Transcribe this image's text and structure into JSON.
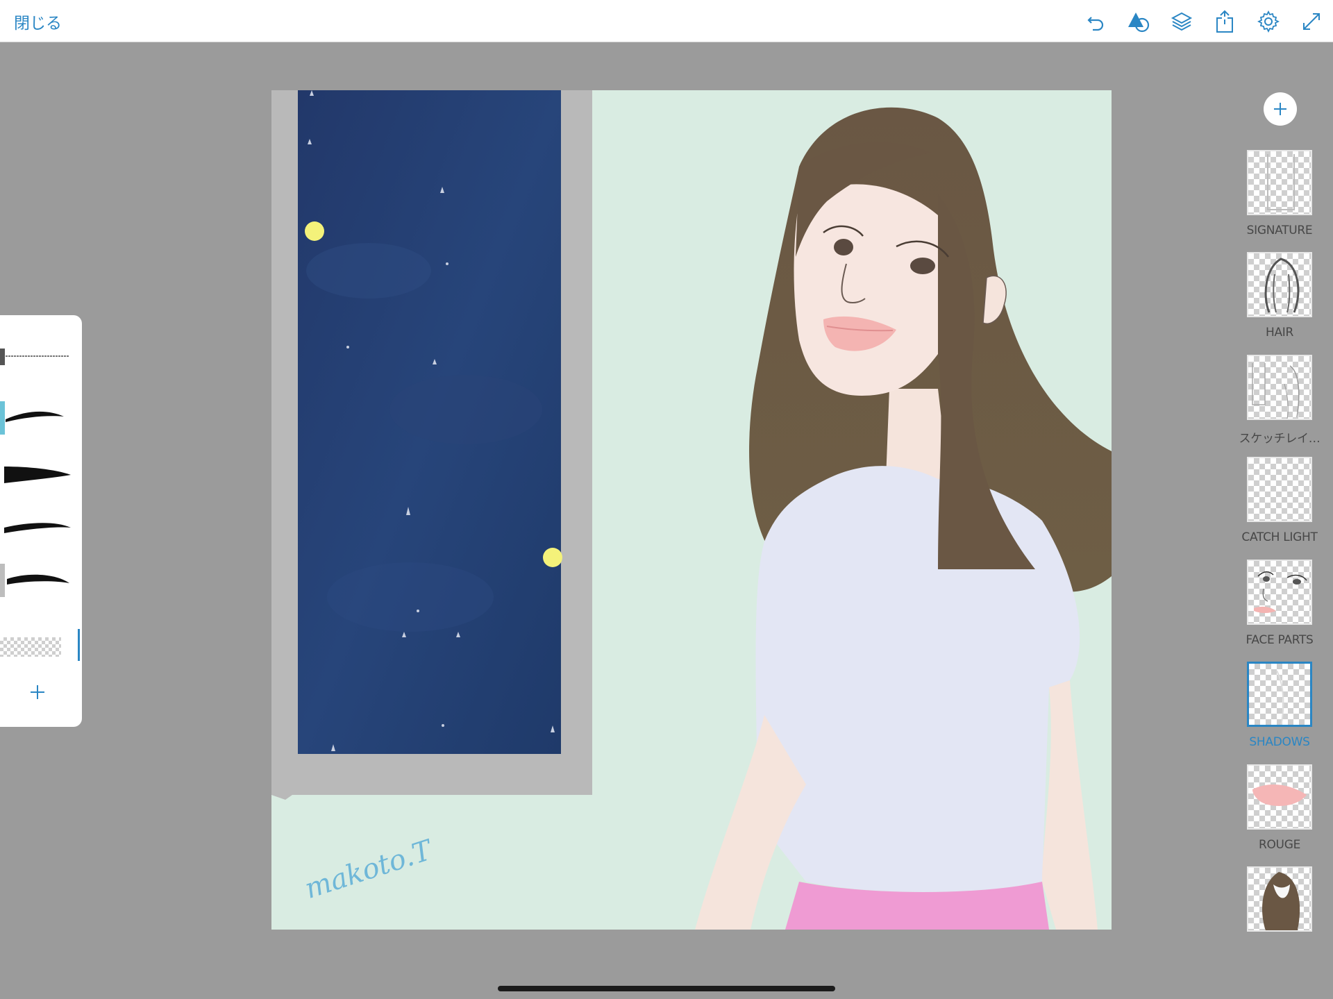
{
  "topbar": {
    "close_label": "閉じる",
    "icons": [
      "undo-icon",
      "shape-icon",
      "layers-icon",
      "share-icon",
      "gear-icon",
      "fullscreen-icon"
    ]
  },
  "canvas": {
    "signature_text": "makoto.T",
    "colors": {
      "background": "#d9ece2",
      "window_frame": "#b9b9b9",
      "night_sky": "#243d6b",
      "hair": "#6e5c45",
      "shirt": "#e3e6f4",
      "skirt": "#ef9bd3",
      "skin": "#f7e6e0"
    }
  },
  "brush_panel": {
    "brushes": [
      "brush-1",
      "brush-2",
      "brush-3",
      "brush-4",
      "brush-5",
      "eraser-brush"
    ],
    "selected_index": 1,
    "add_icon": "plus-icon"
  },
  "layers_panel": {
    "add_icon": "plus-icon",
    "layers": [
      {
        "label": "SIGNATURE",
        "selected": false
      },
      {
        "label": "HAIR",
        "selected": false
      },
      {
        "label": "スケッチレイ…",
        "selected": false
      },
      {
        "label": "CATCH LIGHT",
        "selected": false
      },
      {
        "label": "FACE PARTS",
        "selected": false
      },
      {
        "label": "SHADOWS",
        "selected": true
      },
      {
        "label": "ROUGE",
        "selected": false
      },
      {
        "label": "",
        "selected": false
      }
    ]
  },
  "accent_color": "#2a86c4"
}
